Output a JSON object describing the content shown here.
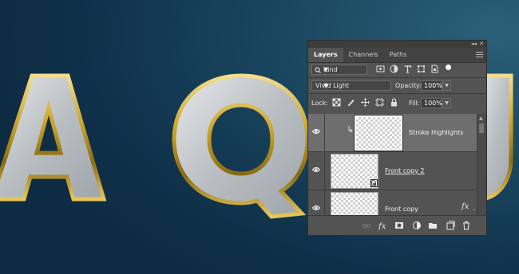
{
  "canvas": {
    "letters": [
      "A",
      "Q",
      "U"
    ]
  },
  "layers_panel": {
    "collapse_label": "◂◂",
    "close_label": "✕",
    "tabs": [
      {
        "label": "Layers",
        "active": true
      },
      {
        "label": "Channels",
        "active": false
      },
      {
        "label": "Paths",
        "active": false
      }
    ],
    "filter": {
      "kind_label": "Kind",
      "filter_icons": [
        "image-filter-icon",
        "adjustment-filter-icon",
        "type-filter-icon",
        "shape-filter-icon",
        "smart-object-filter-icon",
        "filter-toggle-icon"
      ]
    },
    "blend": {
      "mode": "Vivid Light",
      "opacity_label": "Opacity:",
      "opacity_value": "100%"
    },
    "lock": {
      "label": "Lock:",
      "lock_icons": [
        "lock-transparent-pixels-icon",
        "lock-image-pixels-icon",
        "lock-position-icon",
        "lock-artboard-icon",
        "lock-all-icon"
      ],
      "fill_label": "Fill:",
      "fill_value": "100%"
    },
    "layers": [
      {
        "name": "Stroke Highlights",
        "visible": true,
        "selected": true,
        "clipped": true
      },
      {
        "name": "Front copy 2",
        "visible": true,
        "selected": false,
        "smart_object": true
      },
      {
        "name": "Front copy",
        "visible": true,
        "selected": false,
        "has_fx": true
      }
    ],
    "fx_label": "fx",
    "bottom_icons": [
      "link-layers-icon",
      "add-layer-style-icon",
      "add-layer-mask-icon",
      "new-adjustment-layer-icon",
      "new-group-icon",
      "new-layer-icon",
      "delete-layer-icon"
    ],
    "colors": {
      "panel_bg": "#535353",
      "selected_row": "#6e6e6e",
      "canvas_bg": "#1a4760",
      "gold": "#c9a227"
    }
  }
}
